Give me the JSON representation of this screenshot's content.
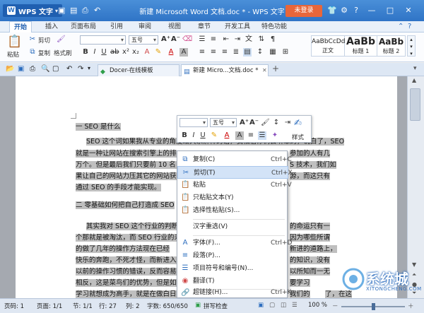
{
  "titlebar": {
    "app_button": "WPS 文字",
    "app_logo": "W",
    "doc_title": "新建 Microsoft Word 文档.doc * - WPS 文字",
    "login": "未登录",
    "icons": [
      "shirt-icon",
      "gear-icon",
      "help-icon",
      "minimize-icon",
      "maximize-icon",
      "close-icon"
    ]
  },
  "ribbon_tabs": [
    "开始",
    "插入",
    "页面布局",
    "引用",
    "审阅",
    "视图",
    "章节",
    "开发工具",
    "特色功能"
  ],
  "ribbon": {
    "paste": "粘贴",
    "cut": "剪切",
    "copy": "复制",
    "format_painter": "格式刷",
    "font_name": "",
    "font_size": "五号",
    "styles": [
      {
        "preview": "AaBbCcDd",
        "label": "正文"
      },
      {
        "preview": "AaBb",
        "label": "标题 1"
      },
      {
        "preview": "AaBb",
        "label": "标题 2"
      }
    ]
  },
  "doc_tabs": [
    {
      "label": "Docer-在线模板"
    },
    {
      "label": "新建 Micro...文档.doc *"
    }
  ],
  "document": {
    "lines": [
      "一  SEO 是什么",
      "SEO 这个词如果我从专业的角度给大家解释的话，我相信你们会听晕的，说白了，SEO",
      "就是一种让网站在搜索引擎上的排",
      "万个。但是最后我们只要前 10 名，",
      "果让自己的网站力压其它的网站获",
      "通过 SEO 的手段才能实现。",
      "二    零基础如何把自己打造成 SEO",
      "其实我对 SEO 这个行业的判断是",
      "个那就是被淘汰，而 SEO 行业的未",
      "的做了几年的操作方法现在已经",
      "快乐的奔跑，不死才怪，而新进入",
      "以前的操作习惯的错误，反而容易",
      "相反，这是菜鸟们的优势，但是如何",
      "学习就想成为高手，就是在做白日",
      "群来学习，开头是三七二，中间是"
    ],
    "lines_right": [
      "参加的人有几",
      "S 技术，我们如",
      "源，而这只有",
      "的命运只有一",
      "因为哪些所谓",
      "新进的道路上，",
      "的知识，没有",
      "以所知而一无",
      "要学习",
      "我们的",
      "了，在这"
    ]
  },
  "float_toolbar": {
    "font_size": "五号",
    "style_label": "样式"
  },
  "context_menu": [
    {
      "label": "复制(C)",
      "shortcut": "Ctrl+C",
      "icon": "copy-icon"
    },
    {
      "label": "剪切(T)",
      "shortcut": "Ctrl+X",
      "icon": "cut-icon"
    },
    {
      "label": "粘贴",
      "shortcut": "Ctrl+V",
      "icon": "paste-icon"
    },
    {
      "label": "只粘贴文本(Y)",
      "shortcut": "",
      "icon": "paste-text-icon"
    },
    {
      "label": "选择性粘贴(S)...",
      "shortcut": "",
      "icon": "paste-special-icon"
    },
    {
      "label": "汉字重选(V)",
      "shortcut": "",
      "icon": ""
    },
    {
      "label": "字体(F)...",
      "shortcut": "Ctrl+D",
      "icon": "font-icon"
    },
    {
      "label": "段落(P)...",
      "shortcut": "",
      "icon": "paragraph-icon"
    },
    {
      "label": "项目符号和编号(N)...",
      "shortcut": "",
      "icon": "bullets-icon"
    },
    {
      "label": "翻译(T)",
      "shortcut": "",
      "icon": "translate-icon"
    },
    {
      "label": "超链接(H)...",
      "shortcut": "Ctrl+K",
      "icon": "hyperlink-icon"
    }
  ],
  "status": {
    "page": "页码: 1",
    "pages": "页面: 1/1",
    "section": "节: 1/1",
    "line": "行: 27",
    "col": "列: 2",
    "words": "字数: 650/650",
    "spell": "拼写检查",
    "zoom": "100 %"
  },
  "watermark": {
    "main": "系统城",
    "sub": "XITONGCHENG.COM"
  }
}
